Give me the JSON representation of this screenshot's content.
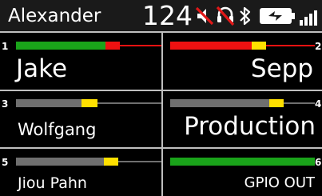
{
  "status_bar": {
    "user_name": "Alexander",
    "channel_number": "124",
    "icons": [
      "speaker-muted-icon",
      "headset-muted-icon",
      "bluetooth-icon",
      "battery-charging-icon",
      "signal-strength-icon"
    ]
  },
  "keys": [
    {
      "number": "1",
      "label": "Jake"
    },
    {
      "number": "2",
      "label": "Sepp"
    },
    {
      "number": "3",
      "label": "Wolfgang"
    },
    {
      "number": "4",
      "label": "Production"
    },
    {
      "number": "5",
      "label": "Jiou Pahn"
    },
    {
      "number": "6",
      "label": "GPIO OUT"
    }
  ],
  "colors": {
    "background": "#000000",
    "status_bar": "#1a1a1a",
    "divider": "#bfbfbf",
    "meter_green": "#1aa31a",
    "meter_red": "#ee1111",
    "meter_yellow": "#ffe000",
    "meter_gray": "#6f6f6f"
  }
}
